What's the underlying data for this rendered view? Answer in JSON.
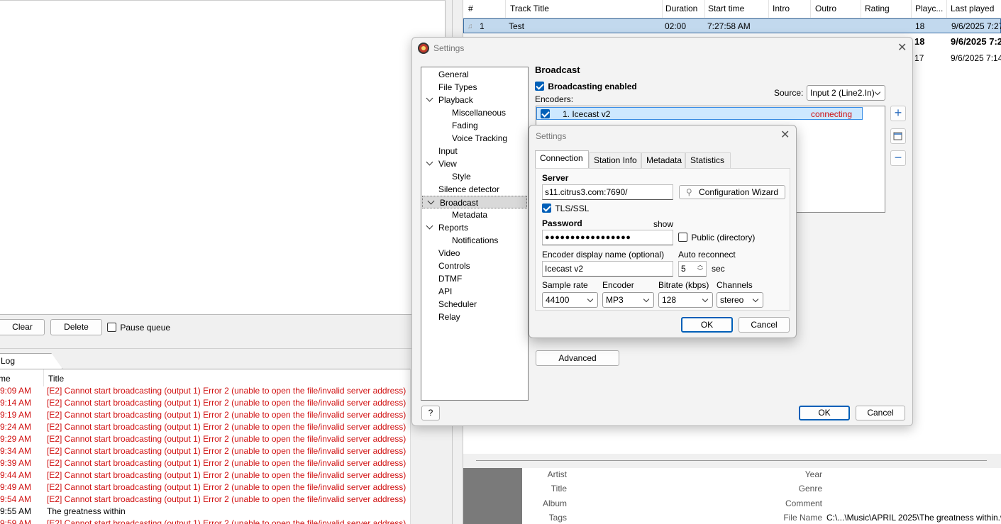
{
  "queue": {
    "clear_label": "Clear",
    "delete_label": "Delete",
    "pause_label": "Pause queue"
  },
  "log": {
    "tab_label": "Log",
    "col_time": "me",
    "col_title": "Title",
    "rows": [
      {
        "time": "9:09 AM",
        "title": "[E2] Cannot start broadcasting (output 1) Error 2 (unable to open the file/invalid server address)"
      },
      {
        "time": "9:14 AM",
        "title": "[E2] Cannot start broadcasting (output 1) Error 2 (unable to open the file/invalid server address)"
      },
      {
        "time": "9:19 AM",
        "title": "[E2] Cannot start broadcasting (output 1) Error 2 (unable to open the file/invalid server address)"
      },
      {
        "time": "9:24 AM",
        "title": "[E2] Cannot start broadcasting (output 1) Error 2 (unable to open the file/invalid server address)"
      },
      {
        "time": "9:29 AM",
        "title": "[E2] Cannot start broadcasting (output 1) Error 2 (unable to open the file/invalid server address)"
      },
      {
        "time": "9:34 AM",
        "title": "[E2] Cannot start broadcasting (output 1) Error 2 (unable to open the file/invalid server address)"
      },
      {
        "time": "9:39 AM",
        "title": "[E2] Cannot start broadcasting (output 1) Error 2 (unable to open the file/invalid server address)"
      },
      {
        "time": "9:44 AM",
        "title": "[E2] Cannot start broadcasting (output 1) Error 2 (unable to open the file/invalid server address)"
      },
      {
        "time": "9:49 AM",
        "title": "[E2] Cannot start broadcasting (output 1) Error 2 (unable to open the file/invalid server address)"
      },
      {
        "time": "9:54 AM",
        "title": "[E2] Cannot start broadcasting (output 1) Error 2 (unable to open the file/invalid server address)"
      },
      {
        "time": "9:55 AM",
        "title": "The greatness within"
      },
      {
        "time": "9:59 AM",
        "title": "[E2] Cannot start broadcasting (output 1) Error 2 (unable to open the file/invalid server address)"
      }
    ]
  },
  "playlist": {
    "columns": [
      "#",
      "Track Title",
      "Duration",
      "Start time",
      "Intro",
      "Outro",
      "Rating",
      "Playc...",
      "Last played"
    ],
    "rows": [
      {
        "num": "1",
        "title": "Test",
        "duration": "02:00",
        "start": "7:27:58 AM",
        "playcount": "18",
        "last": "9/6/2025 7:27:"
      },
      {
        "num": "",
        "title": "",
        "duration": "",
        "start": "",
        "playcount": "18",
        "last": "9/6/2025 7:2"
      },
      {
        "num": "",
        "title": "",
        "duration": "",
        "start": "",
        "playcount": "17",
        "last": "9/6/2025 7:14:"
      }
    ]
  },
  "info": {
    "artist": "Artist",
    "title": "Title",
    "album": "Album",
    "tags": "Tags",
    "year": "Year",
    "genre": "Genre",
    "comment": "Comment",
    "file_name": "File Name",
    "file_name_value": "C:\\...\\Music\\APRIL 2025\\The greatness within.w"
  },
  "settings": {
    "title": "Settings",
    "tree": [
      {
        "label": "General",
        "level": 0
      },
      {
        "label": "File Types",
        "level": 0
      },
      {
        "label": "Playback",
        "level": 0,
        "expanded": true
      },
      {
        "label": "Miscellaneous",
        "level": 1
      },
      {
        "label": "Fading",
        "level": 1
      },
      {
        "label": "Voice Tracking",
        "level": 1
      },
      {
        "label": "Input",
        "level": 0
      },
      {
        "label": "View",
        "level": 0,
        "expanded": true
      },
      {
        "label": "Style",
        "level": 1
      },
      {
        "label": "Silence detector",
        "level": 0
      },
      {
        "label": "Broadcast",
        "level": 0,
        "expanded": true,
        "selected": true
      },
      {
        "label": "Metadata",
        "level": 1
      },
      {
        "label": "Reports",
        "level": 0,
        "expanded": true
      },
      {
        "label": "Notifications",
        "level": 1
      },
      {
        "label": "Video",
        "level": 0
      },
      {
        "label": "Controls",
        "level": 0
      },
      {
        "label": "DTMF",
        "level": 0
      },
      {
        "label": "API",
        "level": 0
      },
      {
        "label": "Scheduler",
        "level": 0
      },
      {
        "label": "Relay",
        "level": 0
      }
    ],
    "broadcast_heading": "Broadcast",
    "broadcasting_enabled": "Broadcasting enabled",
    "encoders_label": "Encoders:",
    "source_label": "Source:",
    "source_value": "Input 2 (Line2.In)",
    "encoder_name": "1. Icecast v2",
    "encoder_status": "connecting",
    "advanced_label": "Advanced",
    "help_label": "?",
    "ok_label": "OK",
    "cancel_label": "Cancel",
    "colors": {
      "accent": "#005fb8",
      "status": "#d01010"
    }
  },
  "encoder_dialog": {
    "title": "Settings",
    "tabs": [
      "Connection",
      "Station Info",
      "Metadata",
      "Statistics"
    ],
    "server_label": "Server",
    "server_value": "s11.citrus3.com:7690/",
    "wizard_label": "Configuration Wizard",
    "tls_label": "TLS/SSL",
    "password_label": "Password",
    "show_label": "show",
    "password_value": "●●●●●●●●●●●●●●●●●",
    "public_label": "Public (directory)",
    "display_name_label": "Encoder display name (optional)",
    "display_name_value": "Icecast v2",
    "auto_reconnect_label": "Auto reconnect",
    "auto_reconnect_value": "5",
    "sec_label": "sec",
    "sample_rate_label": "Sample rate",
    "sample_rate_value": "44100",
    "encoder_label": "Encoder",
    "encoder_value": "MP3",
    "bitrate_label": "Bitrate (kbps)",
    "bitrate_value": "128",
    "channels_label": "Channels",
    "channels_value": "stereo",
    "ok_label": "OK",
    "cancel_label": "Cancel"
  }
}
